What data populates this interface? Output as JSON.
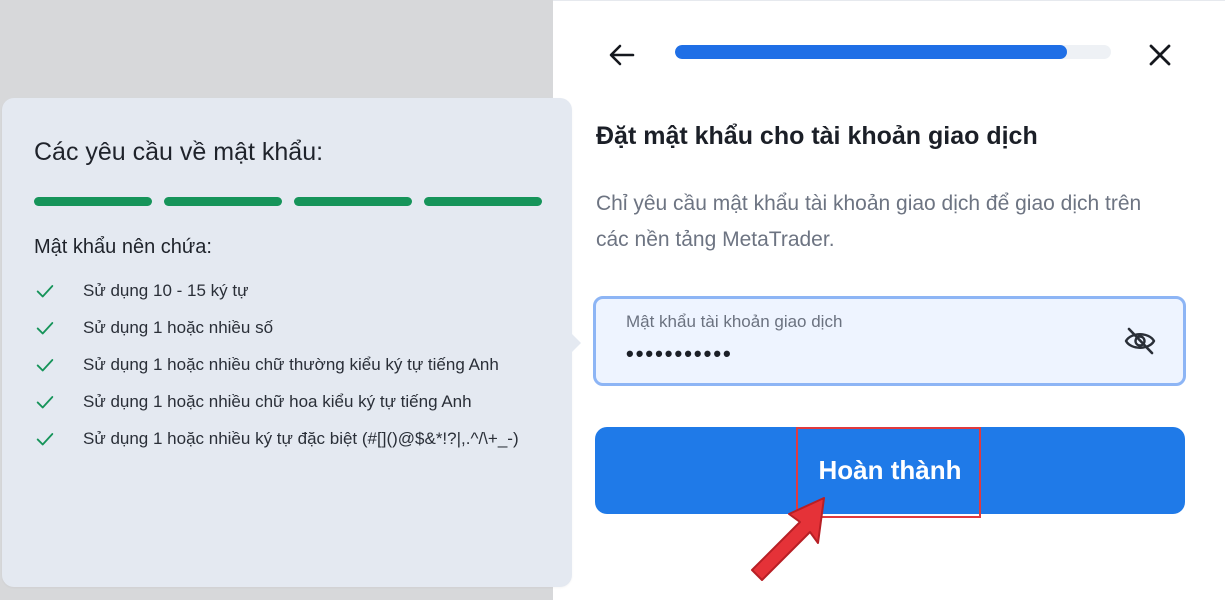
{
  "requirements": {
    "title": "Các yêu cầu về mật khẩu:",
    "strength_segments": 4,
    "strength_color": "#16945a",
    "subtitle": "Mật khẩu nên chứa:",
    "items": [
      {
        "text": "Sử dụng 10 - 15 ký tự"
      },
      {
        "text": "Sử dụng 1 hoặc nhiều số"
      },
      {
        "text": "Sử dụng 1 hoặc nhiều chữ thường kiểu ký tự tiếng Anh"
      },
      {
        "text": "Sử dụng 1 hoặc nhiều chữ hoa kiểu ký tự tiếng Anh"
      },
      {
        "text": "Sử dụng 1 hoặc nhiều ký tự đặc biệt (#[]()@$&*!?|,.^/\\+_-)"
      }
    ],
    "check_icon": "check-icon"
  },
  "topbar": {
    "back_icon": "arrow-left-icon",
    "progress": 0.9,
    "progress_color": "#1f6fe6",
    "close_icon": "close-icon"
  },
  "form": {
    "heading": "Đặt mật khẩu cho tài khoản giao dịch",
    "description": "Chỉ yêu cầu mật khẩu tài khoản giao dịch để giao dịch trên các nền tảng MetaTrader.",
    "password_label": "Mật khẩu tài khoản giao dịch",
    "password_value": "•••••••••••",
    "visibility_icon": "eye-off-icon",
    "submit_label": "Hoàn thành",
    "accent_color": "#1f7ae8"
  },
  "annotation": {
    "highlight_color": "#e03a3e"
  }
}
